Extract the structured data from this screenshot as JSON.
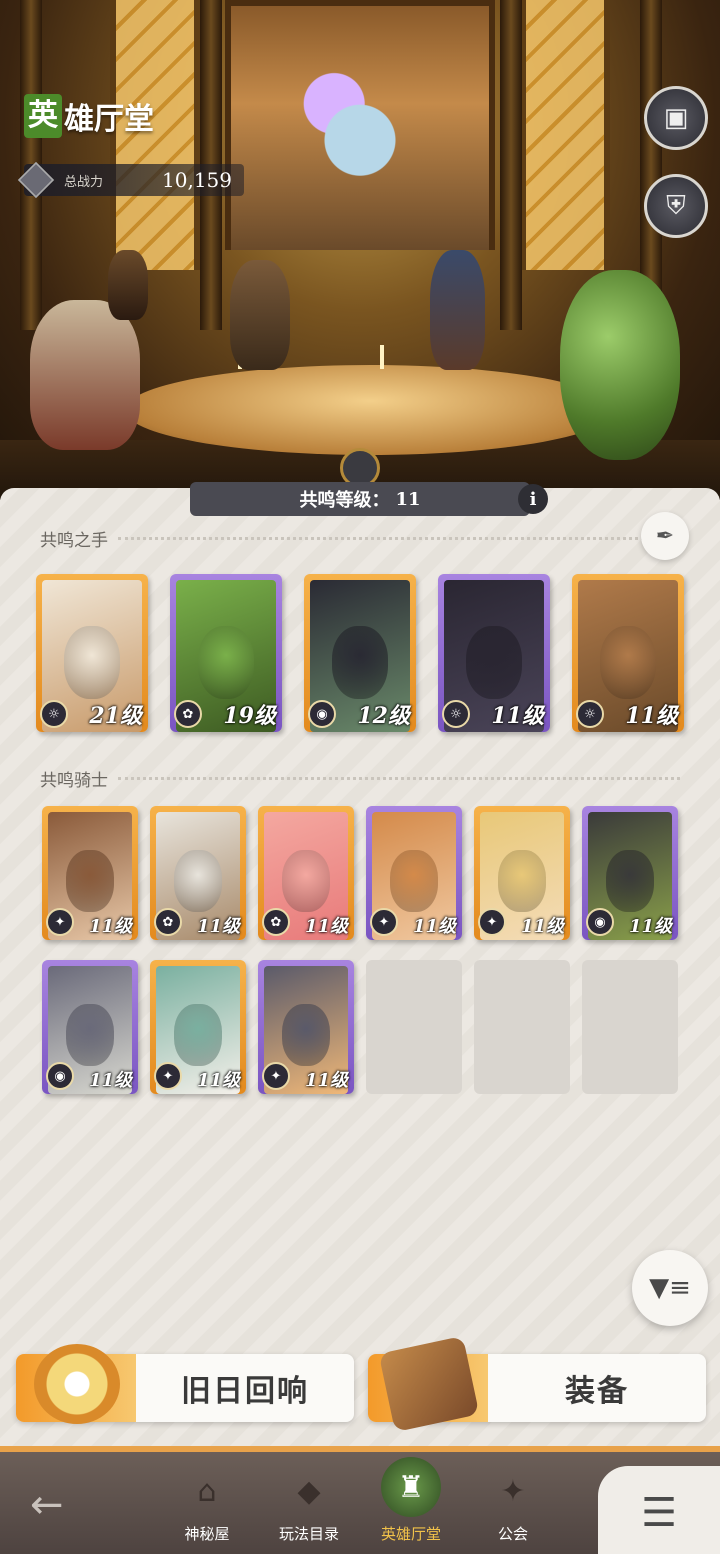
{
  "header": {
    "title_first_char": "英",
    "title_rest": "雄厅堂",
    "power_label": "总战力",
    "power_value": "10,159"
  },
  "side_buttons": {
    "top_icon": "book-icon",
    "second_icon": "armor-icon"
  },
  "resonance": {
    "label": "共鸣等级：",
    "level": "11",
    "info_icon": "i"
  },
  "hands_section": {
    "title": "共鸣之手",
    "cards": [
      {
        "level": "21级",
        "rarity": "orange",
        "faction": "light-icon"
      },
      {
        "level": "19级",
        "rarity": "purple",
        "faction": "nature-icon"
      },
      {
        "level": "12级",
        "rarity": "orange",
        "faction": "dark-icon"
      },
      {
        "level": "11级",
        "rarity": "purple",
        "faction": "light-icon"
      },
      {
        "level": "11级",
        "rarity": "orange",
        "faction": "light-icon"
      }
    ]
  },
  "knights_section": {
    "title": "共鸣骑士",
    "cards": [
      {
        "level": "11级",
        "rarity": "orange",
        "faction": "star-icon"
      },
      {
        "level": "11级",
        "rarity": "orange",
        "faction": "nature-icon"
      },
      {
        "level": "11级",
        "rarity": "orange",
        "faction": "nature-icon"
      },
      {
        "level": "11级",
        "rarity": "purple",
        "faction": "star-icon"
      },
      {
        "level": "11级",
        "rarity": "orange",
        "faction": "star-icon"
      },
      {
        "level": "11级",
        "rarity": "purple",
        "faction": "dark-icon"
      },
      {
        "level": "11级",
        "rarity": "purple",
        "faction": "dark-icon"
      },
      {
        "level": "11级",
        "rarity": "orange",
        "faction": "star-icon"
      },
      {
        "level": "11级",
        "rarity": "purple",
        "faction": "star-icon"
      }
    ],
    "empty_slots": 3
  },
  "actions": {
    "echo_label": "旧日回响",
    "equip_label": "装备"
  },
  "nav": {
    "items": [
      {
        "label": "神秘屋"
      },
      {
        "label": "玩法目录"
      },
      {
        "label": "英雄厅堂"
      },
      {
        "label": "公会"
      }
    ],
    "active_index": 2
  },
  "colors": {
    "accent_orange": "#f39a2a",
    "active_tab": "#f1c24a",
    "title_green": "#4c8b2a"
  }
}
